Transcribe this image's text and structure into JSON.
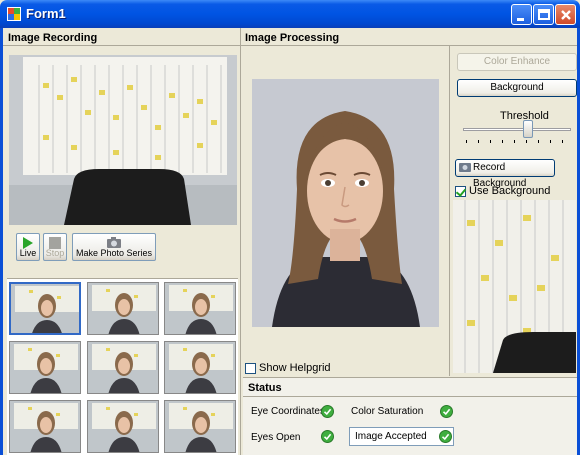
{
  "window": {
    "title": "Form1"
  },
  "recording": {
    "header": "Image Recording",
    "buttons": {
      "live": "Live",
      "stop": "Stop",
      "photo_series": "Make Photo Series"
    }
  },
  "processing": {
    "header": "Image Processing",
    "show_helpgrid": "Show Helpgrid",
    "color_enhance": "Color Enhance",
    "background": "Background",
    "threshold": "Threshold",
    "threshold_level": 0.6,
    "record_background": "Record Background",
    "use_background": "Use Background",
    "use_background_checked": true,
    "show_helpgrid_checked": false
  },
  "status": {
    "header": "Status",
    "eye_coordinates": "Eye Coordinates",
    "color_saturation": "Color Saturation",
    "eyes_open": "Eyes Open",
    "image_accepted": "Image Accepted"
  },
  "icons": {
    "live": "play-icon",
    "stop": "stop-icon",
    "photo": "camera-icon",
    "record": "record-icon",
    "status_ok": "check-circle-icon"
  },
  "colors": {
    "accent": "#0054e3",
    "ok": "#3fae3f",
    "selection": "#3169c6"
  }
}
